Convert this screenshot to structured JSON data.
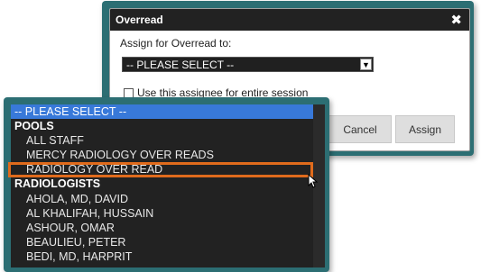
{
  "dialog": {
    "title": "Overread",
    "close_glyph": "✖",
    "assign_label": "Assign for Overread to:",
    "select_value": "-- PLEASE SELECT --",
    "session_checkbox_label": "Use this assignee for entire session",
    "session_checked": false,
    "cancel_label": "Cancel",
    "assign_button_label": "Assign"
  },
  "dropdown": {
    "rows": [
      {
        "label": "-- PLEASE SELECT --",
        "kind": "selected"
      },
      {
        "label": "POOLS",
        "kind": "group"
      },
      {
        "label": "ALL STAFF",
        "kind": "item"
      },
      {
        "label": "MERCY RADIOLOGY OVER READS",
        "kind": "item"
      },
      {
        "label": "RADIOLOGY OVER READ",
        "kind": "item"
      },
      {
        "label": "RADIOLOGISTS",
        "kind": "group"
      },
      {
        "label": "AHOLA, MD, DAVID",
        "kind": "item"
      },
      {
        "label": "AL KHALIFAH, HUSSAIN",
        "kind": "item"
      },
      {
        "label": "ASHOUR, OMAR",
        "kind": "item"
      },
      {
        "label": "BEAULIEU, PETER",
        "kind": "item"
      },
      {
        "label": "BEDI, MD, HARPRIT",
        "kind": "item"
      }
    ]
  },
  "colors": {
    "frame": "#2c6e73",
    "highlight": "#e06b1c",
    "selected_row": "#3879d9"
  }
}
